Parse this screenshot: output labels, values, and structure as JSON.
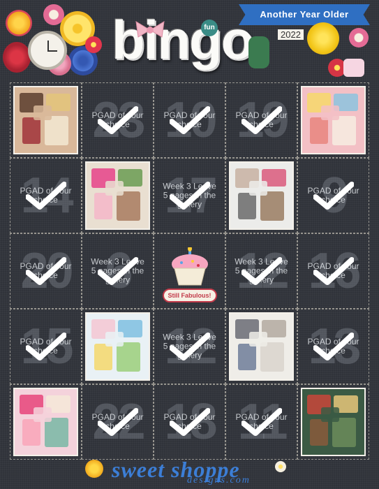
{
  "header": {
    "title": "bingo",
    "badge": "fun",
    "banner": "Another Year Older",
    "year": "2022"
  },
  "cells": [
    {
      "type": "photo",
      "num": "",
      "text": "",
      "colors": [
        "#d9b89a",
        "#5a3d2e",
        "#e3c47a",
        "#a0323a",
        "#f2e8d2"
      ]
    },
    {
      "type": "check",
      "num": "23",
      "text": "PGAD of your choice"
    },
    {
      "type": "check",
      "num": "10",
      "text": "PGAD of your choice"
    },
    {
      "type": "check",
      "num": "19",
      "text": "PGAD of your choice"
    },
    {
      "type": "photo",
      "num": "",
      "text": "",
      "colors": [
        "#f3c0c5",
        "#f6d86a",
        "#8cc3de",
        "#e8857e",
        "#f6ece0"
      ]
    },
    {
      "type": "check",
      "num": "14",
      "text": "PGAD of your choice"
    },
    {
      "type": "photo",
      "num": "",
      "text": "",
      "colors": [
        "#e9dfd1",
        "#e6438a",
        "#6a9c52",
        "#f5b7c9",
        "#a87b5f"
      ]
    },
    {
      "type": "check",
      "num": "17",
      "text": "Week 3 Leave 5 pages in the gallery"
    },
    {
      "type": "photo",
      "num": "",
      "text": "",
      "colors": [
        "#ececea",
        "#c8b2a2",
        "#db5b7c",
        "#6b6b6b",
        "#9a7c61"
      ]
    },
    {
      "type": "check",
      "num": "9",
      "text": "PGAD of your choice"
    },
    {
      "type": "check",
      "num": "20",
      "text": "PGAD of your choice"
    },
    {
      "type": "check",
      "num": "6",
      "text": "Week 3 Leave 5 pages in the gallery"
    },
    {
      "type": "free",
      "num": "",
      "text": "Still Fabulous!"
    },
    {
      "type": "check",
      "num": "12",
      "text": "Week 3 Leave 5 pages in the gallery"
    },
    {
      "type": "check",
      "num": "16",
      "text": "PGAD of your choice"
    },
    {
      "type": "check",
      "num": "15",
      "text": "PGAD of your choice"
    },
    {
      "type": "photo",
      "num": "",
      "text": "",
      "colors": [
        "#e9f1f5",
        "#f4c7d2",
        "#7fc0e0",
        "#f5d86b",
        "#9bcf7a"
      ]
    },
    {
      "type": "check",
      "num": "12",
      "text": "Week 3 Leave 5 pages in the gallery"
    },
    {
      "type": "photo",
      "num": "",
      "text": "",
      "colors": [
        "#efede8",
        "#6a6b74",
        "#b3a9a0",
        "#6e7d99",
        "#d9d3cc"
      ]
    },
    {
      "type": "check",
      "num": "13",
      "text": "PGAD of your choice"
    },
    {
      "type": "photo",
      "num": "",
      "text": "",
      "colors": [
        "#f4d2db",
        "#e6457a",
        "#f4e9d8",
        "#f9a6b8",
        "#78b8a4"
      ]
    },
    {
      "type": "check",
      "num": "22",
      "text": "PGAD of your choice"
    },
    {
      "type": "check",
      "num": "18",
      "text": "PGAD of your choice"
    },
    {
      "type": "check",
      "num": "11",
      "text": "PGAD of your choice"
    },
    {
      "type": "photo",
      "num": "",
      "text": "",
      "colors": [
        "#3b5a44",
        "#c9473a",
        "#e7c77a",
        "#8a5a3b",
        "#6c8c5a"
      ]
    }
  ],
  "footer": {
    "brand": "sweet shoppe",
    "sub": "designs.com"
  }
}
